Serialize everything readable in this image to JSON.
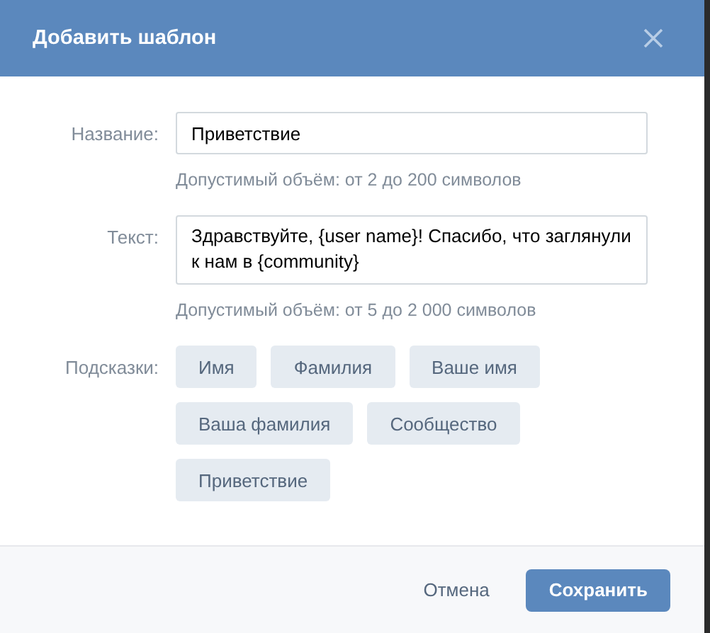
{
  "dialog": {
    "title": "Добавить шаблон"
  },
  "fields": [
    {
      "label": "Название:",
      "value": "Приветствие",
      "hint": "Допустимый объём: от 2 до 200 символов",
      "kind": "input"
    },
    {
      "label": "Текст:",
      "value": "Здравствуйте, {user name}! Спасибо, что заглянули к нам в {community}",
      "hint": "Допустимый объём: от 5 до 2 000 символов",
      "kind": "textarea"
    }
  ],
  "suggestions": {
    "label": "Подсказки:",
    "items": [
      "Имя",
      "Фамилия",
      "Ваше имя",
      "Ваша фамилия",
      "Сообщество",
      "Приветствие"
    ]
  },
  "buttons": {
    "cancel": "Отмена",
    "save": "Сохранить"
  }
}
